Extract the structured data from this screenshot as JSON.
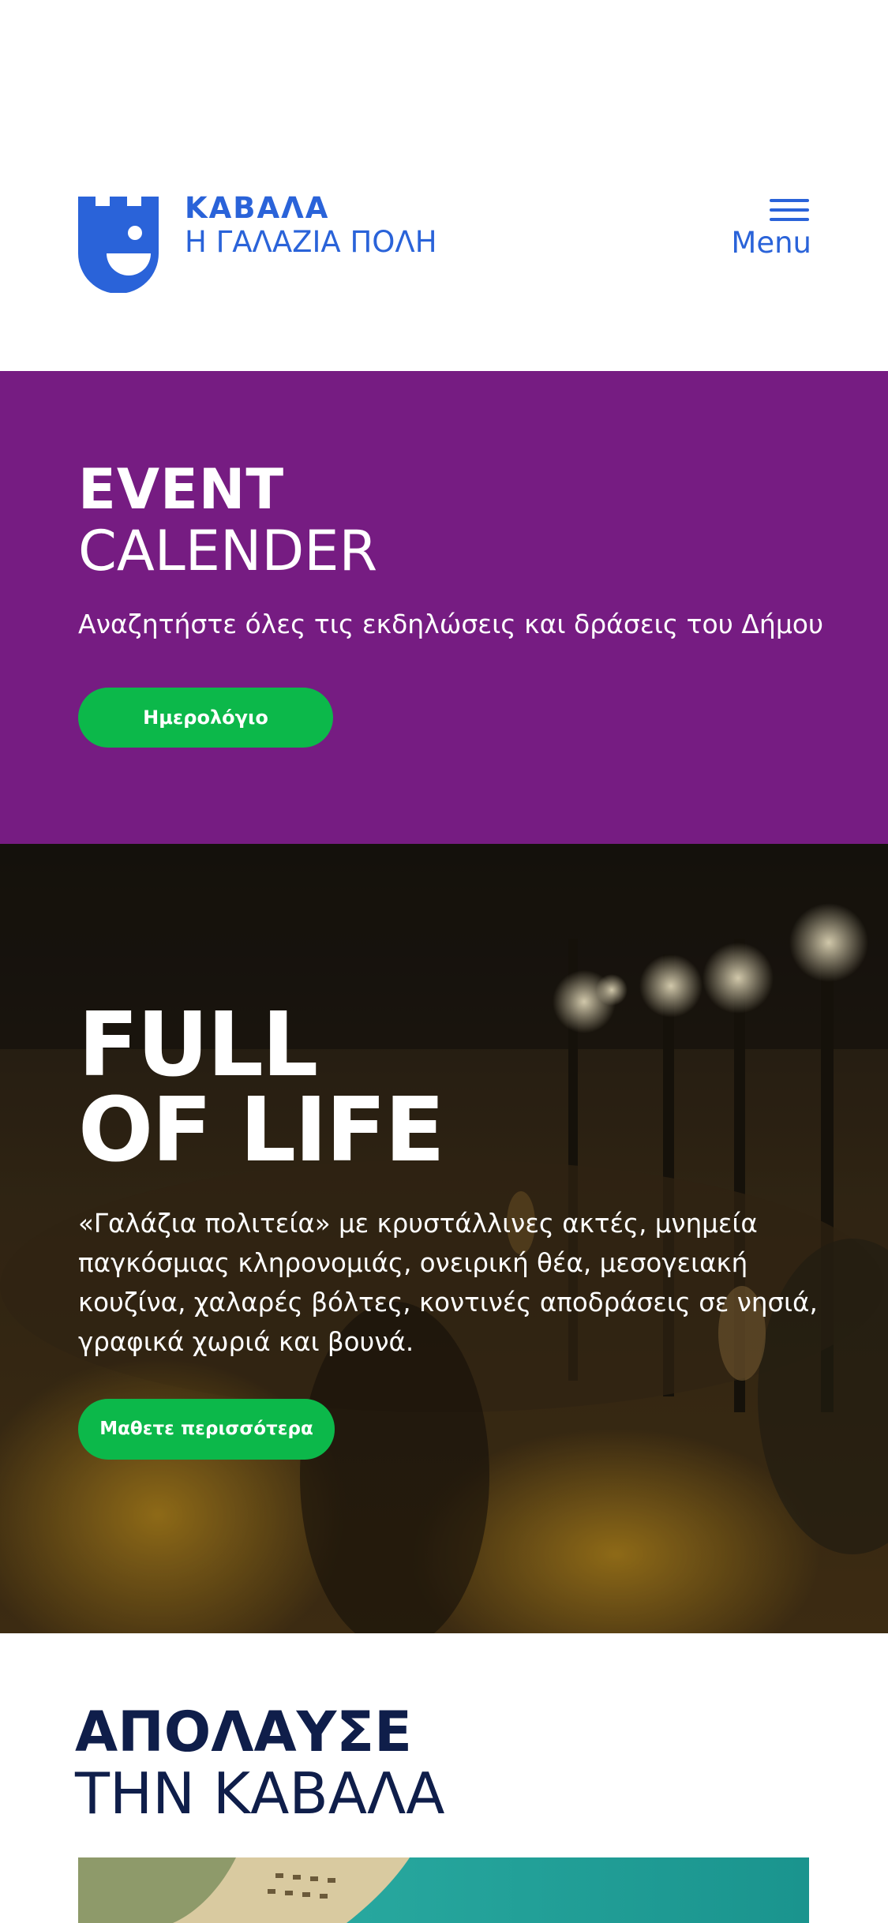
{
  "header": {
    "brand_name": "ΚΑΒΑΛΑ",
    "brand_tagline": "Η ΓΑΛΑΖΙΑ ΠΟΛΗ",
    "menu_label": "Menu",
    "brand_color": "#2a63d9"
  },
  "events": {
    "title_bold": "EVENT",
    "title_light": "CALENDER",
    "description": "Αναζητήστε όλες τις εκδηλώσεις και δράσεις του Δήμου",
    "button_label": "Ημερολόγιο",
    "background_color": "#761c82",
    "button_color": "#0cb84a"
  },
  "hero": {
    "title_line1": "FULL",
    "title_line2": "OF LIFE",
    "description": "«Γαλάζια πολιτεία» με κρυστάλλινες ακτές, μνημεία παγκόσμιας κληρονομιάς, ονειρική θέα, μεσογειακή κουζίνα, χαλαρές βόλτες, κοντινές αποδράσεις σε νησιά, γραφικά χωριά και βουνά.",
    "button_label": "Μαθετε περισσότερα"
  },
  "enjoy": {
    "title_line1": "ΑΠΟΛΑΥΣΕ",
    "title_line2": "ΤΗΝ ΚΑΒΑΛΑ",
    "title_color": "#0f1e4a"
  }
}
